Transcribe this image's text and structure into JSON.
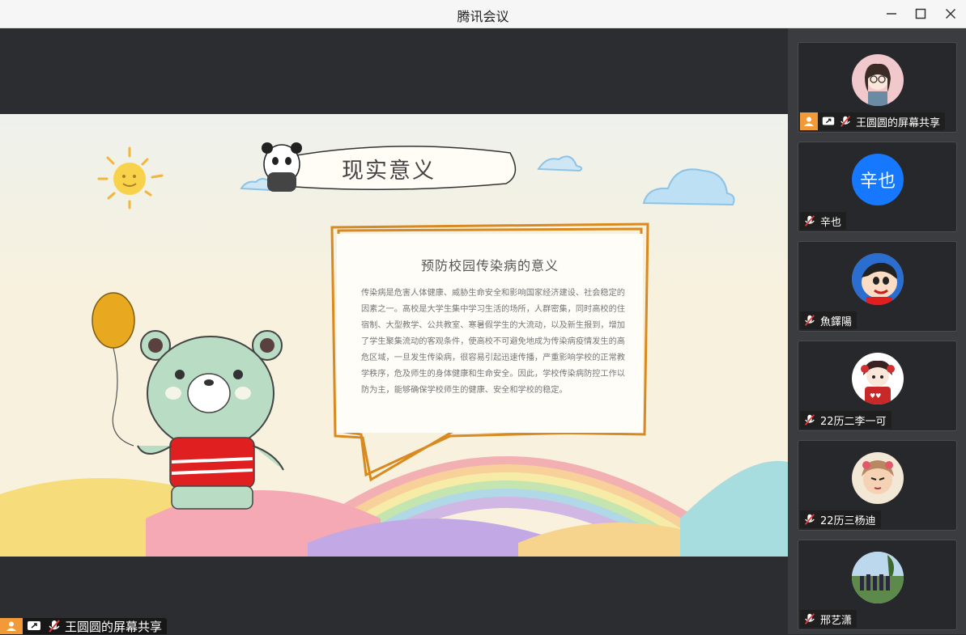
{
  "window": {
    "title": "腾讯会议",
    "minimize_icon": "minimize-icon",
    "maximize_icon": "maximize-icon",
    "close_icon": "close-icon"
  },
  "slide": {
    "title": "现实意义",
    "card_heading": "预防校园传染病的意义",
    "card_body": "传染病是危害人体健康、威胁生命安全和影响国家经济建设、社会稳定的因素之一。高校是大学生集中学习生活的场所，人群密集，同时高校的住宿制、大型教学、公共教室、寒暑假学生的大流动，以及新生报到，增加了学生聚集流动的客观条件，使高校不可避免地成为传染病疫情发生的高危区域，一旦发生传染病，很容易引起迅速传播，严重影响学校的正常教学秩序，危及师生的身体健康和生命安全。因此，学校传染病防控工作以防为主，能够确保学校师生的健康、安全和学校的稳定。"
  },
  "presenter_bar": {
    "label": "王圆圆的屏幕共享"
  },
  "participants": [
    {
      "name": "王圆圆的屏幕共享",
      "avatar": "girl-glasses-avatar",
      "sharing": true,
      "muted": true
    },
    {
      "name": "辛也",
      "avatar_text": "辛也",
      "muted": true
    },
    {
      "name": "魚鐸陽",
      "avatar": "crayon-shinchan-avatar",
      "muted": true
    },
    {
      "name": "22历二李一可",
      "avatar": "cartoon-girl-avatar",
      "muted": true
    },
    {
      "name": "22历三杨迪",
      "avatar": "anime-character-avatar",
      "muted": true
    },
    {
      "name": "邢艺潇",
      "avatar": "group-photo-avatar",
      "muted": true
    }
  ],
  "colors": {
    "accent_orange": "#f29a38",
    "avatar_blue": "#1677ff",
    "sidebar_bg": "#3a3c3f",
    "stage_bg": "#2b2d30"
  }
}
